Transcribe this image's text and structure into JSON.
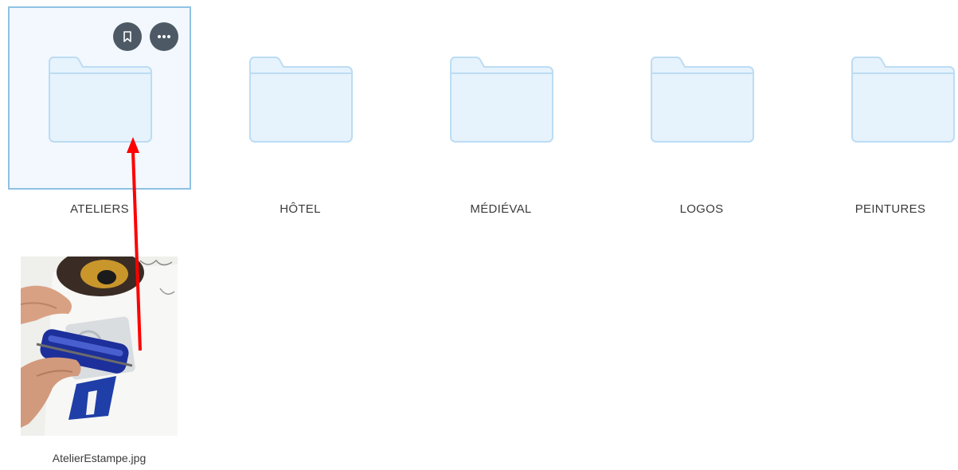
{
  "folders": [
    {
      "name": "ATELIERS",
      "selected": true
    },
    {
      "name": "HÔTEL",
      "selected": false
    },
    {
      "name": "MÉDIÉVAL",
      "selected": false
    },
    {
      "name": "LOGOS",
      "selected": false
    },
    {
      "name": "PEINTURES",
      "selected": false
    }
  ],
  "tile_actions": {
    "bookmark_icon": "bookmark-icon",
    "more_icon": "more-options-icon"
  },
  "files": [
    {
      "name": "AtelierEstampe.jpg",
      "thumbnail": "photo of hands rolling blue ink with a brayer over a print"
    }
  ],
  "colors": {
    "folder_fill": "#e6f3fd",
    "folder_stroke": "#bcdcf3",
    "selection_border": "#8fc1e3",
    "selection_background": "#f2f8fd",
    "action_button": "#4d5a66",
    "annotation_arrow": "#ff0000"
  }
}
